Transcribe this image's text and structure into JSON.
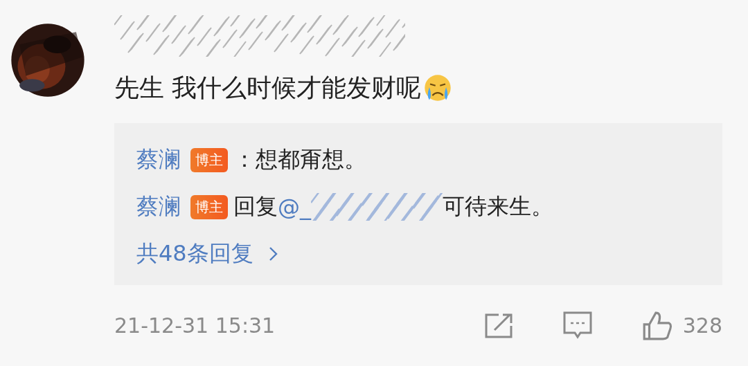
{
  "comment": {
    "text": "先生 我什么时候才能发财呢"
  },
  "replies": [
    {
      "author": "蔡澜",
      "badge": "博主",
      "parts": [
        {
          "kind": "text",
          "text": "：想都甭想。"
        }
      ]
    },
    {
      "author": "蔡澜",
      "badge": "博主",
      "parts": [
        {
          "kind": "text",
          "text": "回复"
        },
        {
          "kind": "mention",
          "text": "@_"
        },
        {
          "kind": "redacted"
        },
        {
          "kind": "text",
          "text": "可待来生。"
        }
      ]
    }
  ],
  "more_replies": "共48条回复",
  "time": "21-12-31 15:31",
  "likes": "328"
}
